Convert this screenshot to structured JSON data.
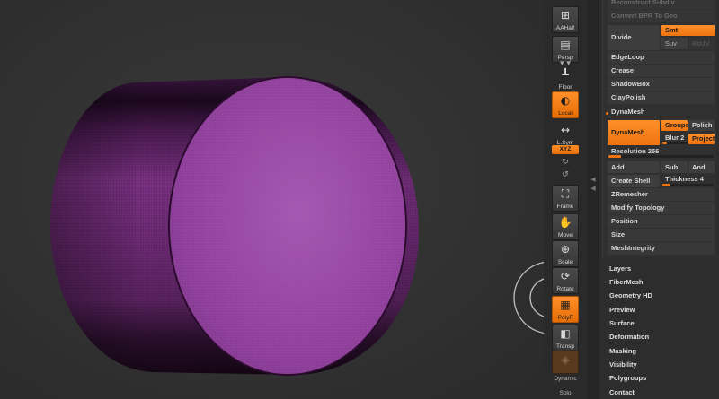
{
  "viewport": {
    "model": "dynamesh-cylinder",
    "colors": {
      "background": "#333333",
      "mesh_dark": "#2a0f2c",
      "mesh_mid": "#6e2a72",
      "cap": "#9b4aa8",
      "wire": "#b46ec0"
    }
  },
  "shelf": {
    "buttons": [
      {
        "label": "AAHalf",
        "icon": "aahalf-icon",
        "active": false
      },
      {
        "label": "Persp",
        "icon": "perspective-icon",
        "active": false
      },
      {
        "label": "Floor",
        "icon": "floor-icon",
        "active": false
      },
      {
        "label": "Local",
        "icon": "local-icon",
        "active": true
      },
      {
        "label": "L.Sym",
        "icon": "lsym-icon",
        "active": false
      },
      {
        "label": "Frame",
        "icon": "frame-icon",
        "active": false
      },
      {
        "label": "Move",
        "icon": "move-hand-icon",
        "active": false
      },
      {
        "label": "Scale",
        "icon": "scale-icon",
        "active": false
      },
      {
        "label": "Rotate",
        "icon": "rotate-icon",
        "active": false
      },
      {
        "label": "PolyF",
        "icon": "polyframe-icon",
        "active": true
      },
      {
        "label": "Transp",
        "icon": "transparency-icon",
        "active": false
      },
      {
        "label": "Dynamic",
        "icon": "dynamic-icon",
        "active": false,
        "dimmed": true
      }
    ],
    "xyz_label": "XYZ",
    "solo_label": "Solo",
    "floor_glyph": "▾ ▾"
  },
  "geometry": {
    "top_rows": [
      "Reconstruct Subdiv",
      "Convert BPR To Geo"
    ],
    "divide": {
      "label": "Divide",
      "smt": "Smt",
      "suv": "Suv",
      "rsuv": "RsUV"
    },
    "rows": [
      "EdgeLoop",
      "Crease",
      "ShadowBox",
      "ClayPolish"
    ],
    "dynamesh": {
      "header": "DynaMesh",
      "button": "DynaMesh",
      "groups": "Groups",
      "polish": "Polish",
      "blur": "Blur 2",
      "blur_value": 0.2,
      "project": "Project",
      "resolution": "Resolution 256",
      "resolution_fraction": 0.12,
      "add": "Add",
      "sub": "Sub",
      "and": "And",
      "create_shell": "Create Shell",
      "thickness": "Thickness 4",
      "thickness_fraction": 0.15
    },
    "rows_after": [
      "ZRemesher",
      "Modify Topology",
      "Position",
      "Size",
      "MeshIntegrity"
    ]
  },
  "sections": [
    "Layers",
    "FiberMesh",
    "Geometry HD",
    "Preview",
    "Surface",
    "Deformation",
    "Masking",
    "Visibility",
    "Polygroups",
    "Contact"
  ]
}
